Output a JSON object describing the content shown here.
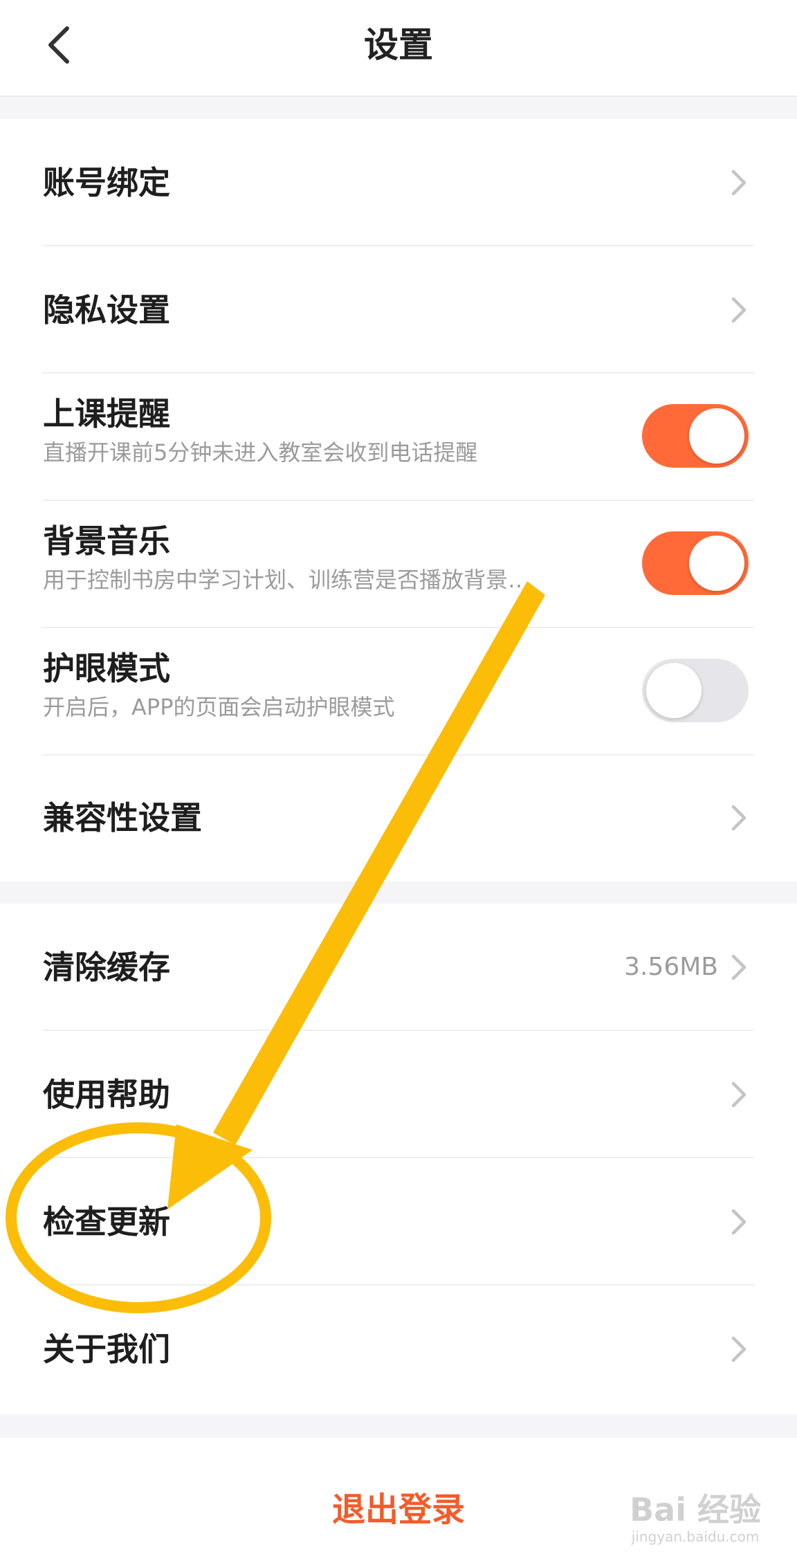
{
  "header": {
    "title": "设置",
    "back_icon": "chevron-left-icon"
  },
  "section1": {
    "items": [
      {
        "label": "账号绑定",
        "type": "link"
      },
      {
        "label": "隐私设置",
        "type": "link"
      },
      {
        "label": "上课提醒",
        "sub": "直播开课前5分钟未进入教室会收到电话提醒",
        "type": "toggle",
        "on": true
      },
      {
        "label": "背景音乐",
        "sub": "用于控制书房中学习计划、训练营是否播放背景…",
        "type": "toggle",
        "on": true
      },
      {
        "label": "护眼模式",
        "sub": "开启后，APP的页面会启动护眼模式",
        "type": "toggle",
        "on": false
      },
      {
        "label": "兼容性设置",
        "type": "link"
      }
    ]
  },
  "section2": {
    "items": [
      {
        "label": "清除缓存",
        "value": "3.56MB",
        "type": "link"
      },
      {
        "label": "使用帮助",
        "type": "link"
      },
      {
        "label": "检查更新",
        "type": "link"
      },
      {
        "label": "关于我们",
        "type": "link"
      }
    ]
  },
  "footer": {
    "logout_label": "退出登录"
  },
  "annotation": {
    "arrow_color": "#fbbd08",
    "circle_color": "#fbbd08"
  },
  "watermark": {
    "main": "Bai 经验",
    "sub": "jingyan.baidu.com"
  },
  "colors": {
    "accent": "#ff6a38",
    "logout": "#f25c2a",
    "toggle_off": "#e6e6ea"
  }
}
